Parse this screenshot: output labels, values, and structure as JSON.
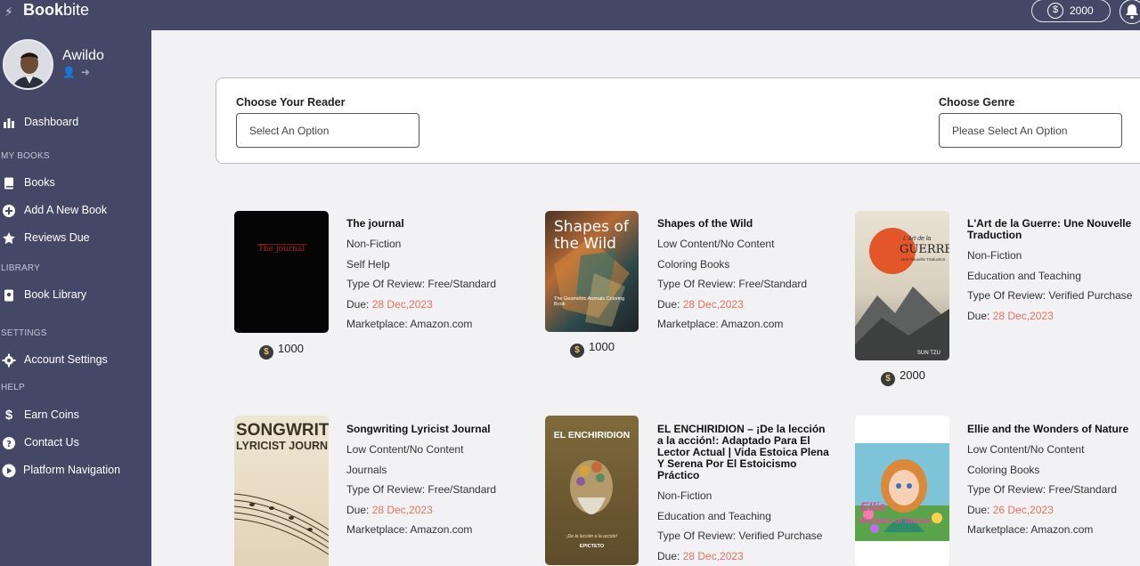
{
  "app": {
    "brand_bold": "Book",
    "brand_light": "bite"
  },
  "header": {
    "coins": "2000"
  },
  "user": {
    "name": "Awildo"
  },
  "sidebar": {
    "dashboard": "Dashboard",
    "section_my_books": "MY BOOKS",
    "books": "Books",
    "add_book": "Add A New Book",
    "reviews_due": "Reviews Due",
    "section_library": "LIBRARY",
    "book_library": "Book Library",
    "section_settings": "SETTINGS",
    "account_settings": "Account Settings",
    "section_help": "HELP",
    "earn_coins": "Earn Coins",
    "contact_us": "Contact Us",
    "platform_navigation": "Platform Navigation"
  },
  "filters": {
    "reader_label": "Choose Your Reader",
    "reader_value": "Select An Option",
    "genre_label": "Choose Genre",
    "genre_value": "Please Select An Option"
  },
  "due_prefix": "Due: ",
  "books": [
    {
      "title": "The journal",
      "category": "Non-Fiction",
      "genre": "Self Help",
      "review": "Type Of Review: Free/Standard",
      "due": "28 Dec,2023",
      "market": "Marketplace: Amazon.com",
      "coins": "1000",
      "cover_text": "The journal"
    },
    {
      "title": "Shapes of the Wild",
      "category": "Low Content/No Content",
      "genre": "Coloring Books",
      "review": "Type Of Review: Free/Standard",
      "due": "28 Dec,2023",
      "market": "Marketplace: Amazon.com",
      "coins": "1000",
      "cover_text": "Shapes of the Wild",
      "cover_sub": "The Geometric Animals Coloring Book"
    },
    {
      "title": "L'Art de la Guerre: Une Nouvelle Traduction",
      "category": "Non-Fiction",
      "genre": "Education and Teaching",
      "review": "Type Of Review: Verified Purchase",
      "due": "28 Dec,2023",
      "coins": "2000",
      "cover_text": "GUERRE",
      "cover_small": "L'Art de la",
      "cover_sub": "Une Nouvelle Traduction",
      "cover_author": "SUN TZU"
    },
    {
      "title": "Songwriting Lyricist Journal",
      "category": "Low Content/No Content",
      "genre": "Journals",
      "review": "Type Of Review: Free/Standard",
      "due": "28 Dec,2023",
      "market": "Marketplace: Amazon.com",
      "cover_text": "SONGWRITI",
      "cover_sub": "LYRICIST JOURN"
    },
    {
      "title": "EL ENCHIRIDION – ¡De la lección a la acción!: Adaptado Para El Lector Actual | Vida Estoica Plena Y Serena Por El Estoicismo Práctico",
      "category": "Non-Fiction",
      "genre": "Education and Teaching",
      "review": "Type Of Review: Verified Purchase",
      "due": "28 Dec,2023",
      "cover_text": "EL ENCHIRIDION",
      "cover_sub": "¡De la lección a la acción!",
      "cover_author": "EPICTETO"
    },
    {
      "title": "Ellie and the Wonders of Nature",
      "category": "Low Content/No Content",
      "genre": "Coloring Books",
      "review": "Type Of Review: Free/Standard",
      "due": "26 Dec,2023",
      "market": "Marketplace: Amazon.com",
      "cover_text": "Ellie",
      "cover_sub": "Wonders of Nature"
    }
  ]
}
